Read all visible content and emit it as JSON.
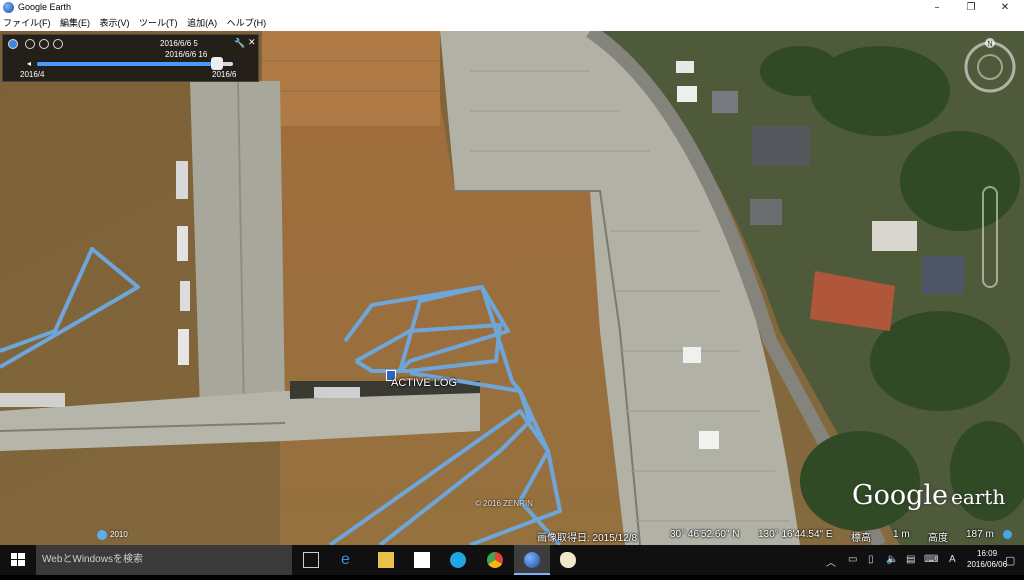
{
  "window": {
    "title": "Google Earth",
    "controls": {
      "minimize": "–",
      "maximize": "❐",
      "close": "✕"
    }
  },
  "menu": [
    "ファイル(F)",
    "編集(E)",
    "表示(V)",
    "ツール(T)",
    "追加(A)",
    "ヘルプ(H)"
  ],
  "time_slider": {
    "range_label": "2016/6/6   5",
    "selected_label": "2016/6/6  16",
    "start_label": "2016/4",
    "end_label": "2016/6",
    "position": 0.92
  },
  "map": {
    "overlay_label": "ACTIVE LOG",
    "copyright": "© 2016 ZENRIN",
    "historical_year": "2010",
    "track_color": "#6ea6da",
    "logo_text_1": "Google",
    "logo_text_2": "earth"
  },
  "status": {
    "imagery_date": "画像取得日: 2015/12/8",
    "latitude": "30° 46'52.60\" N",
    "longitude": "130° 16'44.54\" E",
    "elevation_label": "標高",
    "elevation_value": "1 m",
    "altitude_label": "高度",
    "altitude_value": "187 m"
  },
  "taskbar": {
    "search_placeholder": "WebとWindowsを検索",
    "apps": [
      "task-view-icon",
      "edge-icon",
      "file-explorer-icon",
      "store-icon",
      "skype-icon",
      "chrome-icon",
      "google-earth-icon",
      "paint-icon"
    ],
    "ime": "A",
    "time": "16:09",
    "date": "2016/06/06"
  }
}
